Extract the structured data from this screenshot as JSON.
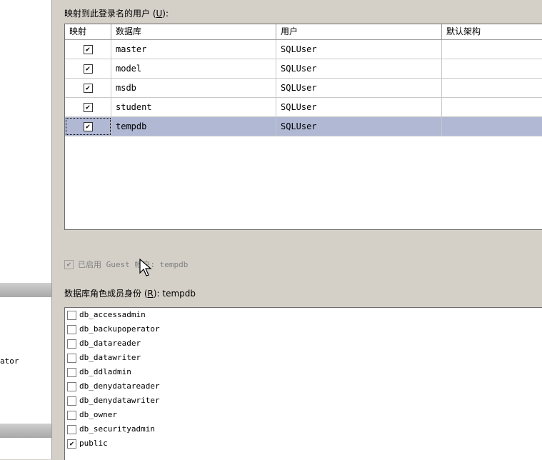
{
  "left_pane": {
    "clipped_text": "ator"
  },
  "mapping": {
    "caption": "映射到此登录名的用户 (",
    "accel": "U",
    "caption_end": "):",
    "columns": [
      "映射",
      "数据库",
      "用户",
      "默认架构"
    ],
    "rows": [
      {
        "mapped": true,
        "database": "master",
        "user": "SQLUser",
        "schema": "",
        "selected": false
      },
      {
        "mapped": true,
        "database": "model",
        "user": "SQLUser",
        "schema": "",
        "selected": false
      },
      {
        "mapped": true,
        "database": "msdb",
        "user": "SQLUser",
        "schema": "",
        "selected": false
      },
      {
        "mapped": true,
        "database": "student",
        "user": "SQLUser",
        "schema": "",
        "selected": false
      },
      {
        "mapped": true,
        "database": "tempdb",
        "user": "SQLUser",
        "schema": "",
        "selected": true
      }
    ]
  },
  "guest": {
    "label": "已启用 Guest 帐户: tempdb",
    "checked": true
  },
  "roles": {
    "caption": "数据库角色成员身份 (",
    "accel": "R",
    "caption_end": "): tempdb",
    "items": [
      {
        "name": "db_accessadmin",
        "checked": false
      },
      {
        "name": "db_backupoperator",
        "checked": false
      },
      {
        "name": "db_datareader",
        "checked": false
      },
      {
        "name": "db_datawriter",
        "checked": false
      },
      {
        "name": "db_ddladmin",
        "checked": false
      },
      {
        "name": "db_denydatareader",
        "checked": false
      },
      {
        "name": "db_denydatawriter",
        "checked": false
      },
      {
        "name": "db_owner",
        "checked": false
      },
      {
        "name": "db_securityadmin",
        "checked": false
      },
      {
        "name": "public",
        "checked": true
      }
    ]
  },
  "colors": {
    "selection": "#b0b8d4",
    "dialog_bg": "#d4d0c8"
  }
}
